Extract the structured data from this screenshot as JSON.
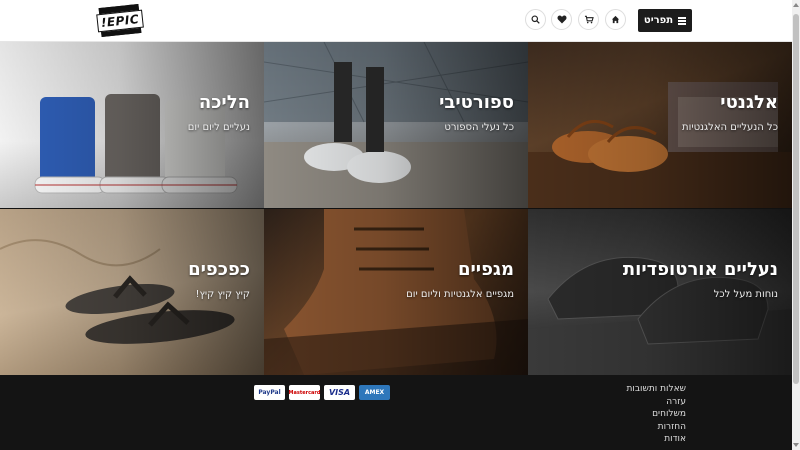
{
  "header": {
    "menu_label": "תפריט",
    "logo_text": "EPIC!",
    "icons": [
      "home-icon",
      "cart-icon",
      "heart-icon",
      "search-icon"
    ]
  },
  "categories": [
    {
      "title": "אלגנטי",
      "subtitle": "כל הנעליים האלגנטיות"
    },
    {
      "title": "ספורטיבי",
      "subtitle": "כל נעלי הספורט"
    },
    {
      "title": "הליכה",
      "subtitle": "נעליים ליום יום"
    },
    {
      "title": "נעליים אורטופדיות",
      "subtitle": "נוחות מעל לכל"
    },
    {
      "title": "מגפיים",
      "subtitle": "מגפיים אלגנטיות וליום יום"
    },
    {
      "title": "כפכפים",
      "subtitle": "קיץ קיץ קיץ!"
    }
  ],
  "footer": {
    "links": [
      "שאלות ותשובות",
      "עזרה",
      "משלוחים",
      "החזרות",
      "אודות"
    ],
    "payments": [
      "PayPal",
      "Mastercard",
      "VISA",
      "AMEX"
    ]
  },
  "colors": {
    "header_bg": "#ffffff",
    "menu_btn": "#1c1c1c",
    "footer_bg": "#141414"
  }
}
